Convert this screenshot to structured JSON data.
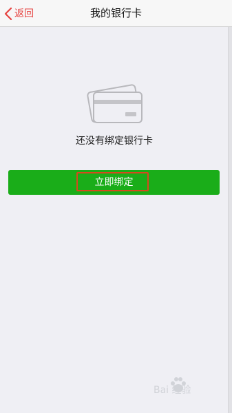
{
  "header": {
    "back_label": "返回",
    "title": "我的银行卡"
  },
  "empty_state": {
    "icon": "bank-card-icon",
    "message": "还没有绑定银行卡"
  },
  "actions": {
    "bind_label": "立即绑定"
  },
  "watermark": {
    "text": "Bai 经验"
  },
  "colors": {
    "accent_red": "#e64340",
    "button_green": "#1aad19",
    "highlight_orange": "#d64a1e",
    "background": "#efeff4"
  }
}
